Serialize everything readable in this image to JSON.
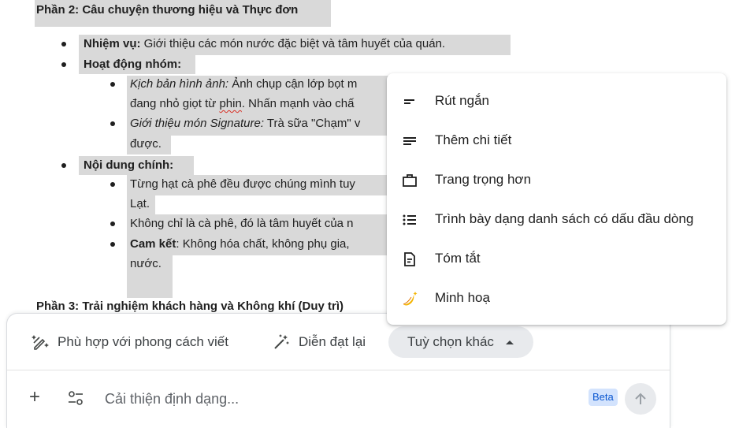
{
  "document": {
    "section2_title": "Phần 2: Câu chuyện thương hiệu và Thực đơn",
    "task_label": "Nhiệm vụ:",
    "task_text": " Giới thiệu các món nước đặc biệt và tâm huyết của quán.",
    "activity_label": "Hoạt động nhóm:",
    "script_label": "Kịch bản hình ảnh:",
    "script_text_1": " Ảnh chụp cận lớp bọt m",
    "script_text_2a": "đang nhỏ giọt từ ",
    "script_text_2b": "phin",
    "script_text_2c": ". Nhấn mạnh vào chấ",
    "signature_label": "Giới thiệu món Signature:",
    "signature_text": " Trà sữa \"Chạm\" v",
    "signature_text_2": "được.",
    "content_label": "Nội dung chính:",
    "content_1a": "Từng hạt cà phê đều được chúng mình tuy",
    "content_1b": "Lạt.",
    "content_2": "Không chỉ là cà phê, đó là tâm huyết của n",
    "commit_label": "Cam kết",
    "commit_text": ": Không hóa chất, không phụ gia,",
    "commit_text_2": "nước.",
    "section3_title": "Phần 3: Trải nghiệm khách hàng và Không khí (Duy trì)"
  },
  "panel": {
    "chip_style": "Phù hợp với phong cách viết",
    "chip_rephrase": "Diễn đạt lại",
    "chip_more": "Tuỳ chọn khác",
    "input_placeholder": "Cải thiện định dạng...",
    "beta_badge": "Beta",
    "plus_symbol": "+"
  },
  "menu": {
    "items": [
      {
        "label": "Rút ngắn",
        "icon": "short-text-icon"
      },
      {
        "label": "Thêm chi tiết",
        "icon": "notes-icon"
      },
      {
        "label": "Trang trọng hơn",
        "icon": "briefcase-icon"
      },
      {
        "label": "Trình bày dạng danh sách có dấu đầu dòng",
        "icon": "bulleted-list-icon"
      },
      {
        "label": "Tóm tắt",
        "icon": "summary-doc-icon"
      },
      {
        "label": "Minh hoạ",
        "icon": "banana-sparkle-icon"
      }
    ]
  },
  "colors": {
    "highlight": "#d9d9d9",
    "chip_active_bg": "#e8eaed",
    "beta_bg": "#d3e3fd",
    "beta_text": "#0b57d0",
    "banana_yellow": "#f4b400"
  }
}
